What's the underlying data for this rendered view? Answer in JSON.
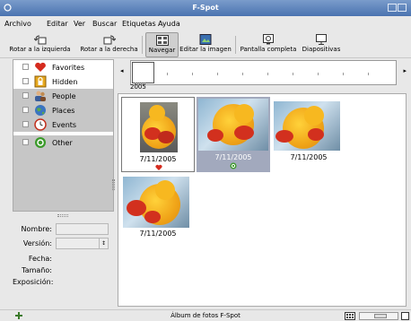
{
  "window": {
    "title": "F-Spot"
  },
  "menu": [
    "Archivo",
    "Editar",
    "Ver",
    "Buscar",
    "Etiquetas",
    "Ayuda"
  ],
  "toolbar": {
    "rotate_left": "Rotar a la izquierda",
    "rotate_right": "Rotar a la derecha",
    "browse": "Navegar",
    "edit_image": "Editar la imagen",
    "fullscreen": "Pantalla completa",
    "slideshow": "Diapositivas"
  },
  "tags": [
    {
      "label": "Favorites",
      "icon": "heart-icon",
      "color": "#d52b1e"
    },
    {
      "label": "Hidden",
      "icon": "lock-icon",
      "color": "#e6a81e"
    },
    {
      "label": "People",
      "icon": "people-icon",
      "color": "#6f7a8c"
    },
    {
      "label": "Places",
      "icon": "globe-icon",
      "color": "#3a74c0"
    },
    {
      "label": "Events",
      "icon": "clock-icon",
      "color": "#c2301e"
    },
    {
      "label": "Other",
      "icon": "other-icon",
      "color": "#3b9a2a"
    }
  ],
  "timeline": {
    "year": "2005",
    "left_arrow": "◂",
    "right_arrow": "▸"
  },
  "info": {
    "name_label": "Nombre:",
    "version_label": "Versión:",
    "date_label": "Fecha:",
    "size_label": "Tamaño:",
    "exposure_label": "Exposición:",
    "version_value": ""
  },
  "photos": [
    {
      "date": "7/11/2005",
      "badge": "heart-icon",
      "state": "focused"
    },
    {
      "date": "7/11/2005",
      "badge": "other-icon",
      "state": "selected"
    },
    {
      "date": "7/11/2005",
      "badge": "",
      "state": "normal"
    },
    {
      "date": "7/11/2005",
      "badge": "",
      "state": "normal"
    }
  ],
  "status": {
    "text": "Álbum de fotos F-Spot"
  },
  "colors": {
    "title_bar": "#4a73b0",
    "selection": "#a2a9bd",
    "sidebar_selected": "#c6c6c6"
  }
}
